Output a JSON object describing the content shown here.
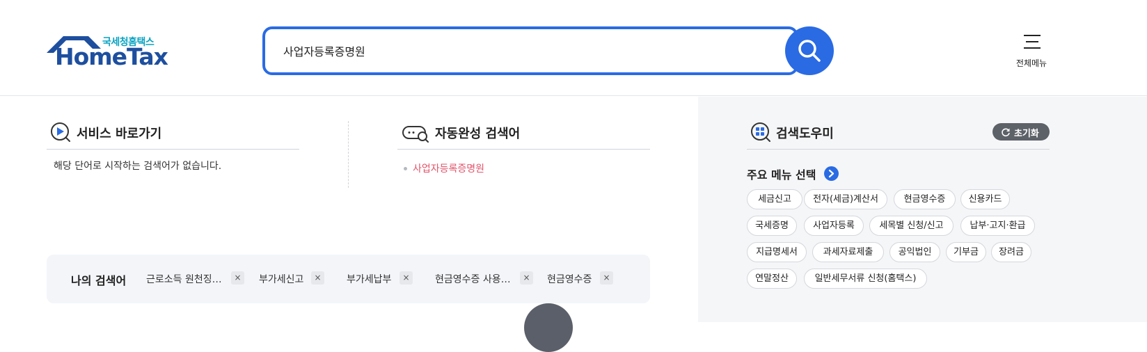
{
  "header": {
    "logo": {
      "sub": "국세청홈택스",
      "main": "HomeTax"
    },
    "search": {
      "value": "사업자등록증명원"
    },
    "menu_label": "전체메뉴"
  },
  "service_shortcut": {
    "title": "서비스 바로가기",
    "empty_message": "해당 단어로 시작하는 검색어가 없습니다."
  },
  "autocomplete": {
    "title": "자동완성 검색어",
    "items": [
      "사업자등록증명원"
    ]
  },
  "my_searches": {
    "title": "나의 검색어",
    "items": [
      "근로소득 원천징…",
      "부가세신고",
      "부가세납부",
      "현금영수증 사용…",
      "현금영수증"
    ],
    "remove_symbol": "×"
  },
  "search_helper": {
    "title": "검색도우미",
    "reset_label": "초기화",
    "main_menu_title": "주요 메뉴 선택",
    "chips": [
      "세금신고",
      "전자(세금)계산서",
      "현금영수증",
      "신용카드",
      "국세증명",
      "사업자등록",
      "세목별 신청/신고",
      "납부·고지·환급",
      "지급명세서",
      "과세자료제출",
      "공익법인",
      "기부금",
      "장려금",
      "연말정산",
      "일반세무서류 신청(홈택스)"
    ]
  },
  "colors": {
    "accent": "#2a6be3",
    "logo_blue": "#1e4f9f",
    "logo_teal": "#0aa3c2",
    "autocomplete_highlight": "#e0566b",
    "panel_bg": "#f5f6f8"
  }
}
